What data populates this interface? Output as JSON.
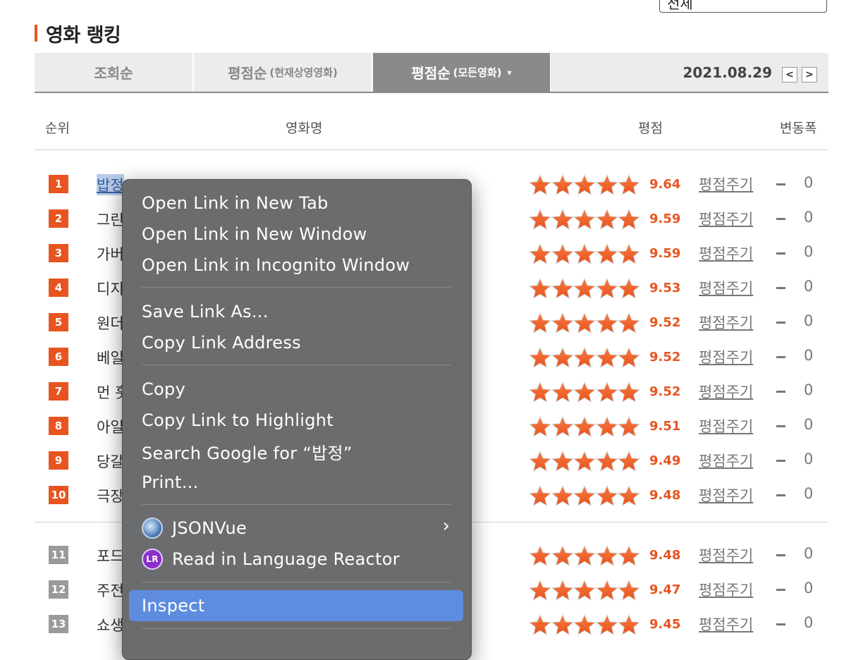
{
  "top_select": {
    "value": "전체"
  },
  "section": {
    "title": "영화 랭킹"
  },
  "tabs": [
    {
      "label": "조회순",
      "sub": ""
    },
    {
      "label": "평점순",
      "sub": "(현재상영영화)"
    },
    {
      "label": "평점순",
      "sub": "(모든영화)",
      "caret": "▾"
    }
  ],
  "date": "2021.08.29",
  "nav": {
    "prev": "<",
    "next": ">"
  },
  "columns": {
    "rank": "순위",
    "title": "영화명",
    "rating": "평점",
    "change": "변동폭"
  },
  "rows": [
    {
      "rank": "1",
      "title": "밥정",
      "score": "9.64",
      "stars": 5,
      "rate": "평점주기",
      "change": "0"
    },
    {
      "rank": "2",
      "title": "그린",
      "score": "9.59",
      "stars": 5,
      "rate": "평점주기",
      "change": "0"
    },
    {
      "rank": "3",
      "title": "가버",
      "score": "9.59",
      "stars": 5,
      "rate": "평점주기",
      "change": "0"
    },
    {
      "rank": "4",
      "title": "디지",
      "score": "9.53",
      "stars": 5,
      "rate": "평점주기",
      "change": "0"
    },
    {
      "rank": "5",
      "title": "원더",
      "score": "9.52",
      "stars": 5,
      "rate": "평점주기",
      "change": "0"
    },
    {
      "rank": "6",
      "title": "베일",
      "score": "9.52",
      "stars": 5,
      "rate": "평점주기",
      "change": "0"
    },
    {
      "rank": "7",
      "title": "먼 훗",
      "score": "9.52",
      "stars": 5,
      "rate": "평점주기",
      "change": "0"
    },
    {
      "rank": "8",
      "title": "아일",
      "score": "9.51",
      "stars": 5,
      "rate": "평점주기",
      "change": "0"
    },
    {
      "rank": "9",
      "title": "당갈",
      "score": "9.49",
      "stars": 5,
      "rate": "평점주기",
      "change": "0"
    },
    {
      "rank": "10",
      "title": "극장",
      "score": "9.48",
      "stars": 5,
      "rate": "평점주기",
      "change": "0"
    },
    {
      "rank": "11",
      "title": "포드",
      "score": "9.48",
      "stars": 5,
      "rate": "평점주기",
      "change": "0"
    },
    {
      "rank": "12",
      "title": "주전",
      "score": "9.47",
      "stars": 5,
      "rate": "평점주기",
      "change": "0"
    },
    {
      "rank": "13",
      "title": "쇼생",
      "score": "9.45",
      "stars": 5,
      "rate": "평점주기",
      "change": "0"
    }
  ],
  "context_menu": {
    "items": [
      "Open Link in New Tab",
      "Open Link in New Window",
      "Open Link in Incognito Window",
      "Save Link As...",
      "Copy Link Address",
      "Copy",
      "Copy Link to Highlight",
      "Search Google for “밥정”",
      "Print...",
      "JSONVue",
      "Read in Language Reactor",
      "Inspect"
    ],
    "lr_badge": "LR",
    "submenu_arrow": "›",
    "highlighted": "Inspect",
    "highlight_color": "#5e8de0"
  },
  "colors": {
    "accent": "#e8541f",
    "rank_gray": "#9a9a9a",
    "menu_bg": "#6b6c6e"
  }
}
